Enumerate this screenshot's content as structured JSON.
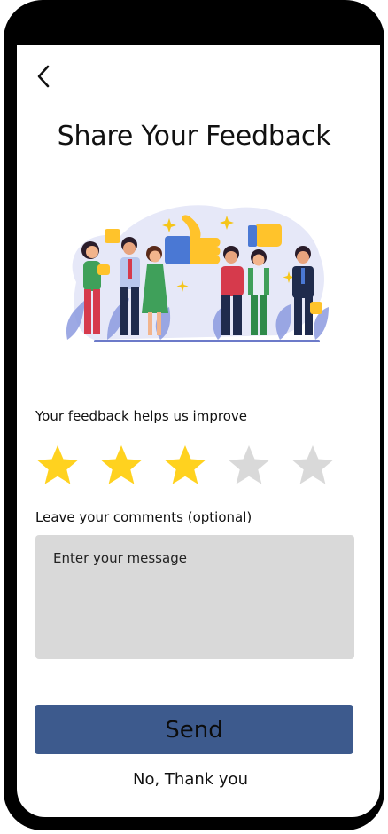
{
  "header": {
    "title": "Share Your Feedback"
  },
  "rating": {
    "prompt": "Your feedback helps us improve",
    "value": 3,
    "max": 5,
    "filled_color": "#ffd21f",
    "empty_color": "#d9d9d9"
  },
  "comments": {
    "label": "Leave your comments (optional)",
    "placeholder": "Enter your message",
    "value": ""
  },
  "actions": {
    "send_label": "Send",
    "decline_label": "No, Thank you"
  },
  "colors": {
    "accent": "#3d5a8d"
  }
}
